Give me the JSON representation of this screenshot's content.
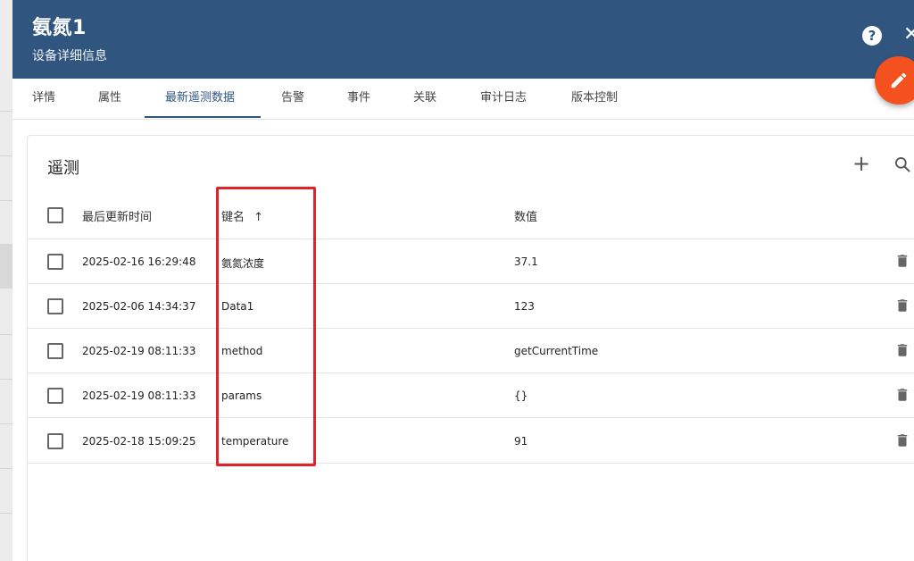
{
  "dialog": {
    "title": "氨氮1",
    "subtitle": "设备详细信息",
    "help_glyph": "?",
    "close_glyph": "✕"
  },
  "tabs": [
    {
      "label": "详情"
    },
    {
      "label": "属性"
    },
    {
      "label": "最新遥测数据",
      "active": true
    },
    {
      "label": "告警"
    },
    {
      "label": "事件"
    },
    {
      "label": "关联"
    },
    {
      "label": "审计日志"
    },
    {
      "label": "版本控制"
    }
  ],
  "card": {
    "title": "遥测",
    "add_glyph": "+"
  },
  "table": {
    "columns": {
      "time": "最后更新时间",
      "key": "键名",
      "sort_glyph": "↑",
      "value": "数值"
    },
    "rows": [
      {
        "time": "2025-02-16 16:29:48",
        "key": "氨氮浓度",
        "value": "37.1"
      },
      {
        "time": "2025-02-06 14:34:37",
        "key": "Data1",
        "value": "123"
      },
      {
        "time": "2025-02-19 08:11:33",
        "key": "method",
        "value": "getCurrentTime"
      },
      {
        "time": "2025-02-19 08:11:33",
        "key": "params",
        "value": "{}"
      },
      {
        "time": "2025-02-18 15:09:25",
        "key": "temperature",
        "value": "91"
      }
    ]
  },
  "colors": {
    "header": "#305680",
    "fab": "#f4511e",
    "highlight": "#e0222b"
  },
  "icons": {
    "fab": "pencil-icon",
    "search": "search-icon",
    "delete": "trash-icon"
  }
}
